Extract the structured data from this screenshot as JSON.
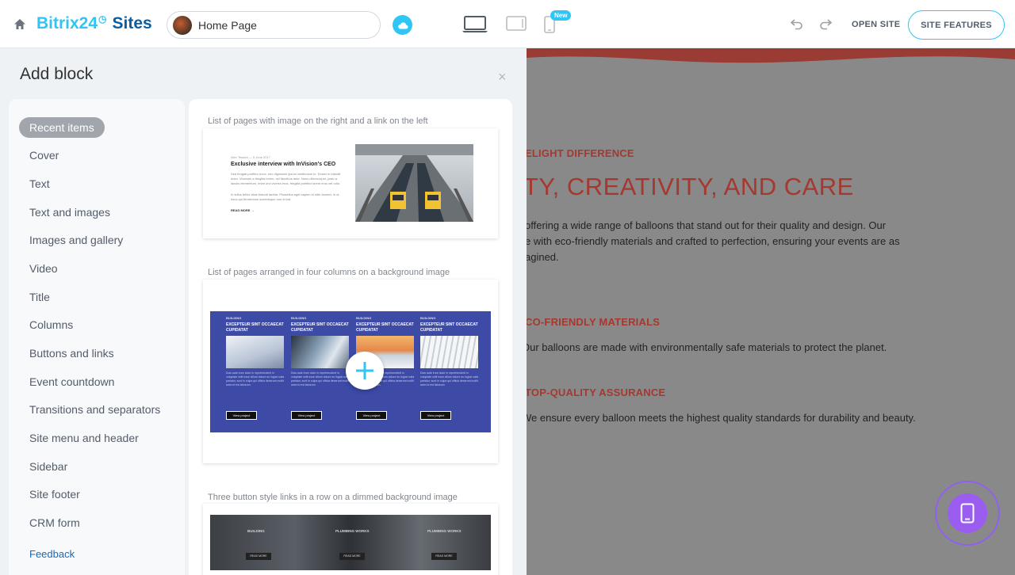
{
  "header": {
    "brand_b24": "Bitrix24",
    "brand_sites": "Sites",
    "page_name": "Home Page",
    "new_badge": "New",
    "open_site": "OPEN SITE",
    "site_features": "SITE FEATURES",
    "icons": [
      "home-icon",
      "cloud-icon",
      "desktop-icon",
      "tablet-icon",
      "mobile-icon",
      "undo-icon",
      "redo-icon"
    ]
  },
  "panel": {
    "title": "Add block",
    "close": "×",
    "categories": [
      "Recent items",
      "Cover",
      "Text",
      "Text and images",
      "Images and gallery",
      "Video",
      "Title",
      "Columns",
      "Buttons and links",
      "Event countdown",
      "Transitions and separators",
      "Site menu and header",
      "Sidebar",
      "Site footer",
      "CRM form"
    ],
    "feedback": "Feedback"
  },
  "blocks": [
    {
      "caption": "List of pages with image on the right and a link on the left",
      "meta": "Alex Teseira  —  5 June 2017",
      "title": "Exclusive interview with InVision's CEO",
      "para1": "Sed feugiat porttitor nunc, nec dignissim ipsum vestibulum in. Donec in blandit dolor. Vivamus a fringilla lorem, vel faucibus ante. Nunc ullamcorper, justo a iaculis elementum, enim orci viverra eros, fringilla porttitor lorem eros vel odio.",
      "para2": "In tellus tellus vitae blandit lacinia. Phasellus eget sapien id nibh laoreet, in ut risus qui fermentum scelerisque non et est.",
      "read_more": "READ MORE →"
    },
    {
      "caption": "List of pages arranged in four columns on a background image",
      "columns": [
        {
          "tag": "BUILDING",
          "heading": "EXCEPTEUR SINT OCCAECAT CUPIDATAT",
          "text": "Duis aute irure dolor in reprehenderit in voluptate velit esse cillum dolore eu fugiat nulla pariatur, sunt in culpa qui officia deserunt mollit anim id est laborum.",
          "button": "View project"
        },
        {
          "tag": "BUILDING",
          "heading": "EXCEPTEUR SINT OCCAECAT CUPIDATAT",
          "text": "Duis aute irure dolor in reprehenderit in voluptate velit esse cillum dolore eu fugiat nulla pariatur, sunt in culpa qui officia deserunt mollit anim id est laborum.",
          "button": "View project"
        },
        {
          "tag": "BUILDING",
          "heading": "EXCEPTEUR SINT OCCAECAT CUPIDATAT",
          "text": "Duis aute irure dolor in reprehenderit in voluptate velit esse cillum dolore eu fugiat nulla pariatur, sunt in culpa qui officia deserunt mollit anim id est laborum.",
          "button": "View project"
        },
        {
          "tag": "BUILDING",
          "heading": "EXCEPTEUR SINT OCCAECAT CUPIDATAT",
          "text": "Duis aute irure dolor in reprehenderit in voluptate velit esse cillum dolore eu fugiat nulla pariatur, sunt in culpa qui officia deserunt mollit anim id est laborum.",
          "button": "View project"
        }
      ]
    },
    {
      "caption": "Three button style links in a row on a dimmed background image",
      "labels": [
        "BUILDING",
        "PLUMBING WORKS",
        "PLUMBING WORKS"
      ],
      "button": "READ MORE"
    }
  ],
  "preview": {
    "label1": "ELIGHT DIFFERENCE",
    "heading": "TY, CREATIVITY, AND CARE",
    "line1": "offering a wide range of balloons that stand out for their quality and design. Our",
    "line2": "e with eco-friendly materials and crafted to perfection, ensuring your events are as",
    "line3": "agined.",
    "label2": "CO-FRIENDLY MATERIALS",
    "text2": "Our balloons are made with environmentally safe materials to protect the planet.",
    "label3": "TOP-QUALITY ASSURANCE",
    "text3": "We ensure every balloon meets the highest quality standards for durability and beauty."
  },
  "colors": {
    "accent": "#2fc6f6",
    "brand_dark": "#0a5fa2",
    "preview_red": "#a5382f",
    "purple": "#9b5cf0"
  }
}
